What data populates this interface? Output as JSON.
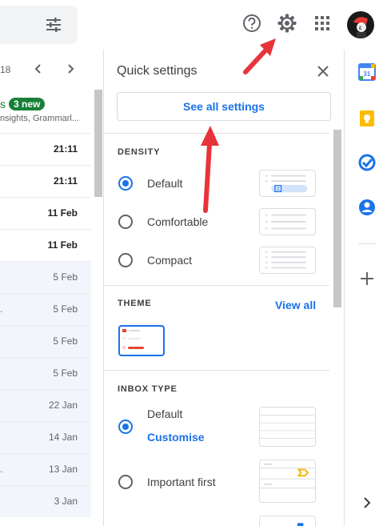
{
  "topbar": {
    "search_filter_icon": "tune-icon",
    "help_icon": "help-icon",
    "settings_icon": "gear-icon",
    "apps_icon": "apps-grid-icon",
    "avatar_icon": "avatar"
  },
  "list": {
    "pager_text": "18",
    "promo_title": "s",
    "new_badge": "3 new",
    "promo_sub": "nsights, Grammarl...",
    "rows": [
      {
        "date": "21:11",
        "unread": true,
        "lead": ""
      },
      {
        "date": "21:11",
        "unread": true,
        "lead": ""
      },
      {
        "date": "11 Feb",
        "unread": true,
        "lead": ""
      },
      {
        "date": "11 Feb",
        "unread": true,
        "lead": ""
      },
      {
        "date": "5 Feb",
        "unread": false,
        "lead": ""
      },
      {
        "date": "5 Feb",
        "unread": false,
        "lead": "."
      },
      {
        "date": "5 Feb",
        "unread": false,
        "lead": ""
      },
      {
        "date": "5 Feb",
        "unread": false,
        "lead": ""
      },
      {
        "date": "22 Jan",
        "unread": false,
        "lead": ""
      },
      {
        "date": "14 Jan",
        "unread": false,
        "lead": ""
      },
      {
        "date": "13 Jan",
        "unread": false,
        "lead": "."
      },
      {
        "date": "3 Jan",
        "unread": false,
        "lead": ""
      }
    ]
  },
  "quick_settings": {
    "title": "Quick settings",
    "see_all_label": "See all settings",
    "density_label": "DENSITY",
    "density_options": [
      {
        "label": "Default",
        "selected": true
      },
      {
        "label": "Comfortable",
        "selected": false
      },
      {
        "label": "Compact",
        "selected": false
      }
    ],
    "theme_label": "THEME",
    "view_all_label": "View all",
    "inbox_type_label": "INBOX TYPE",
    "inbox_options": [
      {
        "label": "Default",
        "selected": true
      },
      {
        "label": "Important first",
        "selected": false
      }
    ],
    "customise_label": "Customise"
  },
  "side_panel": {
    "icons": [
      "calendar-icon",
      "keep-icon",
      "tasks-icon",
      "contacts-icon",
      "add-icon",
      "chevron-right-icon"
    ],
    "calendar_day": "31"
  },
  "colors": {
    "accent": "#1a73e8",
    "annotation_arrow": "#e8333b",
    "new_badge": "#188038"
  }
}
